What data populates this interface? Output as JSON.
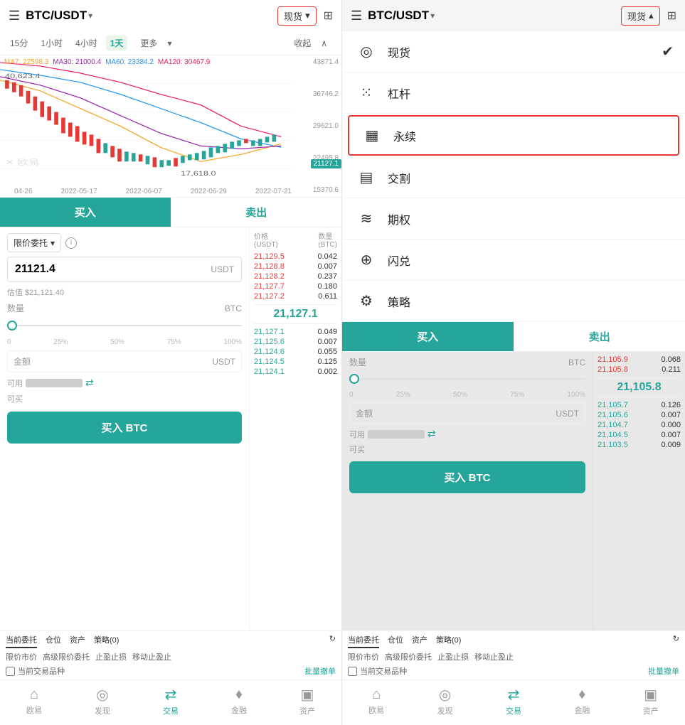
{
  "left": {
    "header": {
      "menu_icon": "☰",
      "pair": "BTC/USDT",
      "arrow": "▾",
      "spot_label": "现货",
      "spot_arrow": "▾",
      "chart_icon": "⊞"
    },
    "time_bar": {
      "options": [
        "15分",
        "1小时",
        "4小时",
        "1天",
        "更多",
        "收起"
      ],
      "active": "1天",
      "more_arrow": "▾",
      "collapse_arrow": "∧"
    },
    "chart": {
      "ma7": "MA7: 22598.3",
      "ma30": "MA30: 21000.4",
      "ma60": "MA60: 23384.2",
      "ma120": "MA120: 30467.9",
      "prices": [
        "43871.4",
        "36746.2",
        "29621.0",
        "22495.8",
        "15370.6"
      ],
      "current_price": "21127.1",
      "dates": [
        "04-26",
        "2022-05-17",
        "2022-06-07",
        "2022-06-29",
        "2022-07-21"
      ],
      "high": "40,623.4",
      "low": "17,618.0",
      "watermark": "✕ 欧易"
    },
    "buy_sell": {
      "buy": "买入",
      "sell": "卖出"
    },
    "order_form": {
      "type": "限价委托",
      "price_value": "21121.4",
      "price_unit": "USDT",
      "estimated": "估值 $21,121.40",
      "quantity_label": "数量",
      "quantity_unit": "BTC",
      "slider_ticks": [
        "0",
        "25%",
        "50%",
        "75%",
        "100%"
      ],
      "amount_label": "金额",
      "amount_unit": "USDT",
      "available_label": "可用",
      "buy_label": "可买",
      "buy_btn": "买入 BTC"
    },
    "order_book": {
      "header_price": "价格",
      "header_price_unit": "(USDT)",
      "header_qty": "数量",
      "header_qty_unit": "(BTC)",
      "sell_orders": [
        {
          "price": "21,129.5",
          "qty": "0.042"
        },
        {
          "price": "21,128.8",
          "qty": "0.007"
        },
        {
          "price": "21,128.2",
          "qty": "0.237"
        },
        {
          "price": "21,127.7",
          "qty": "0.180"
        },
        {
          "price": "21,127.2",
          "qty": "0.611"
        }
      ],
      "current": "21,127.1",
      "buy_orders": [
        {
          "price": "21,127.1",
          "qty": "0.049"
        },
        {
          "price": "21,125.6",
          "qty": "0.007"
        },
        {
          "price": "21,124.6",
          "qty": "0.055"
        },
        {
          "price": "21,124.5",
          "qty": "0.125"
        },
        {
          "price": "21,124.1",
          "qty": "0.002"
        }
      ]
    },
    "bottom_tabs": {
      "tabs": [
        "当前委托",
        "仓位",
        "资产",
        "策略(0)"
      ],
      "refresh_icon": "↻",
      "order_types": [
        "限价市价",
        "高级限价委托",
        "止盈止损",
        "移动止盈止"
      ],
      "checkbox_label": "当前交易品种",
      "batch_btn": "批量撤单"
    },
    "nav": {
      "items": [
        {
          "icon": "⌂",
          "label": "欧易"
        },
        {
          "icon": "◎",
          "label": "发现"
        },
        {
          "icon": "⇄",
          "label": "交易"
        },
        {
          "icon": "♦",
          "label": "金融"
        },
        {
          "icon": "▣",
          "label": "资产"
        }
      ],
      "active": "交易"
    }
  },
  "right": {
    "header": {
      "menu_icon": "☰",
      "pair": "BTC/USDT",
      "arrow": "▾",
      "spot_label": "现货",
      "spot_arrow": "▴",
      "chart_icon": "⊞"
    },
    "dropdown": {
      "items": [
        {
          "icon": "◎",
          "label": "现货",
          "checked": true
        },
        {
          "icon": "⁙",
          "label": "杠杆",
          "checked": false
        },
        {
          "icon": "▦",
          "label": "永续",
          "highlighted": true,
          "checked": false
        },
        {
          "icon": "▤",
          "label": "交割",
          "checked": false
        },
        {
          "icon": "≋",
          "label": "期权",
          "checked": false
        },
        {
          "icon": "⊕",
          "label": "闪兑",
          "checked": false
        },
        {
          "icon": "⚙",
          "label": "策略",
          "checked": false
        }
      ]
    },
    "lower": {
      "buy_sell": {
        "buy": "买入",
        "sell": "卖出"
      },
      "order_book": {
        "sell_orders": [
          {
            "price": "21,105.9",
            "qty": "0.068"
          },
          {
            "price": "21,105.8",
            "qty": "0.211"
          }
        ],
        "current": "21,105.8",
        "buy_orders": [
          {
            "price": "21,105.7",
            "qty": "0.126"
          },
          {
            "price": "21,105.6",
            "qty": "0.007"
          },
          {
            "price": "21,104.7",
            "qty": "0.000"
          },
          {
            "price": "21,104.5",
            "qty": "0.007"
          },
          {
            "price": "21,103.5",
            "qty": "0.009"
          }
        ]
      },
      "order_form": {
        "quantity_label": "数量",
        "quantity_unit": "BTC",
        "amount_label": "金额",
        "amount_unit": "USDT",
        "available_label": "可用",
        "buy_label": "可买",
        "buy_btn": "买入 BTC"
      },
      "bottom_tabs": {
        "tabs": [
          "当前委托",
          "仓位",
          "资产",
          "策略(0)"
        ],
        "order_types": [
          "限价市价",
          "高级限价委托",
          "止盈止损",
          "移动止盈止"
        ],
        "checkbox_label": "当前交易品种",
        "batch_btn": "批量撤单"
      },
      "nav": {
        "items": [
          {
            "icon": "⌂",
            "label": "欧易"
          },
          {
            "icon": "◎",
            "label": "发现"
          },
          {
            "icon": "⇄",
            "label": "交易"
          },
          {
            "icon": "♦",
            "label": "金融"
          },
          {
            "icon": "▣",
            "label": "资产"
          }
        ],
        "active": "交易"
      }
    }
  }
}
